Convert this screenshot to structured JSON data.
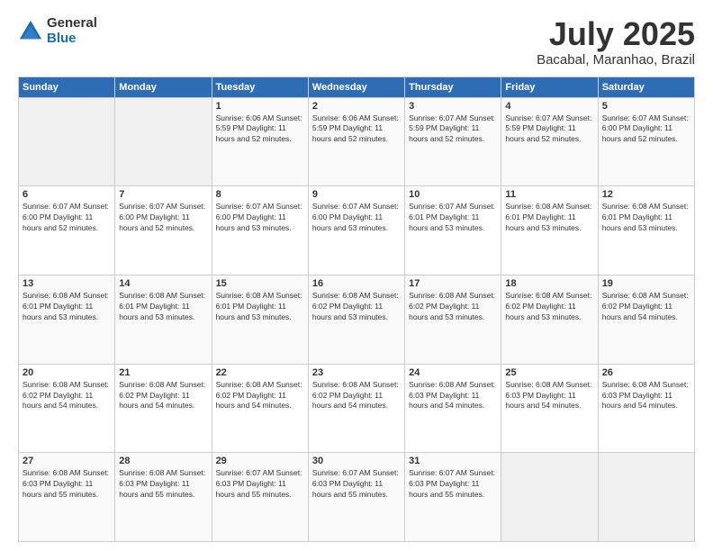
{
  "header": {
    "logo_general": "General",
    "logo_blue": "Blue",
    "title": "July 2025",
    "location": "Bacabal, Maranhao, Brazil"
  },
  "days_of_week": [
    "Sunday",
    "Monday",
    "Tuesday",
    "Wednesday",
    "Thursday",
    "Friday",
    "Saturday"
  ],
  "weeks": [
    [
      {
        "day": "",
        "info": ""
      },
      {
        "day": "",
        "info": ""
      },
      {
        "day": "1",
        "info": "Sunrise: 6:06 AM\nSunset: 5:59 PM\nDaylight: 11 hours\nand 52 minutes."
      },
      {
        "day": "2",
        "info": "Sunrise: 6:06 AM\nSunset: 5:59 PM\nDaylight: 11 hours\nand 52 minutes."
      },
      {
        "day": "3",
        "info": "Sunrise: 6:07 AM\nSunset: 5:59 PM\nDaylight: 11 hours\nand 52 minutes."
      },
      {
        "day": "4",
        "info": "Sunrise: 6:07 AM\nSunset: 5:59 PM\nDaylight: 11 hours\nand 52 minutes."
      },
      {
        "day": "5",
        "info": "Sunrise: 6:07 AM\nSunset: 6:00 PM\nDaylight: 11 hours\nand 52 minutes."
      }
    ],
    [
      {
        "day": "6",
        "info": "Sunrise: 6:07 AM\nSunset: 6:00 PM\nDaylight: 11 hours\nand 52 minutes."
      },
      {
        "day": "7",
        "info": "Sunrise: 6:07 AM\nSunset: 6:00 PM\nDaylight: 11 hours\nand 52 minutes."
      },
      {
        "day": "8",
        "info": "Sunrise: 6:07 AM\nSunset: 6:00 PM\nDaylight: 11 hours\nand 53 minutes."
      },
      {
        "day": "9",
        "info": "Sunrise: 6:07 AM\nSunset: 6:00 PM\nDaylight: 11 hours\nand 53 minutes."
      },
      {
        "day": "10",
        "info": "Sunrise: 6:07 AM\nSunset: 6:01 PM\nDaylight: 11 hours\nand 53 minutes."
      },
      {
        "day": "11",
        "info": "Sunrise: 6:08 AM\nSunset: 6:01 PM\nDaylight: 11 hours\nand 53 minutes."
      },
      {
        "day": "12",
        "info": "Sunrise: 6:08 AM\nSunset: 6:01 PM\nDaylight: 11 hours\nand 53 minutes."
      }
    ],
    [
      {
        "day": "13",
        "info": "Sunrise: 6:08 AM\nSunset: 6:01 PM\nDaylight: 11 hours\nand 53 minutes."
      },
      {
        "day": "14",
        "info": "Sunrise: 6:08 AM\nSunset: 6:01 PM\nDaylight: 11 hours\nand 53 minutes."
      },
      {
        "day": "15",
        "info": "Sunrise: 6:08 AM\nSunset: 6:01 PM\nDaylight: 11 hours\nand 53 minutes."
      },
      {
        "day": "16",
        "info": "Sunrise: 6:08 AM\nSunset: 6:02 PM\nDaylight: 11 hours\nand 53 minutes."
      },
      {
        "day": "17",
        "info": "Sunrise: 6:08 AM\nSunset: 6:02 PM\nDaylight: 11 hours\nand 53 minutes."
      },
      {
        "day": "18",
        "info": "Sunrise: 6:08 AM\nSunset: 6:02 PM\nDaylight: 11 hours\nand 53 minutes."
      },
      {
        "day": "19",
        "info": "Sunrise: 6:08 AM\nSunset: 6:02 PM\nDaylight: 11 hours\nand 54 minutes."
      }
    ],
    [
      {
        "day": "20",
        "info": "Sunrise: 6:08 AM\nSunset: 6:02 PM\nDaylight: 11 hours\nand 54 minutes."
      },
      {
        "day": "21",
        "info": "Sunrise: 6:08 AM\nSunset: 6:02 PM\nDaylight: 11 hours\nand 54 minutes."
      },
      {
        "day": "22",
        "info": "Sunrise: 6:08 AM\nSunset: 6:02 PM\nDaylight: 11 hours\nand 54 minutes."
      },
      {
        "day": "23",
        "info": "Sunrise: 6:08 AM\nSunset: 6:02 PM\nDaylight: 11 hours\nand 54 minutes."
      },
      {
        "day": "24",
        "info": "Sunrise: 6:08 AM\nSunset: 6:03 PM\nDaylight: 11 hours\nand 54 minutes."
      },
      {
        "day": "25",
        "info": "Sunrise: 6:08 AM\nSunset: 6:03 PM\nDaylight: 11 hours\nand 54 minutes."
      },
      {
        "day": "26",
        "info": "Sunrise: 6:08 AM\nSunset: 6:03 PM\nDaylight: 11 hours\nand 54 minutes."
      }
    ],
    [
      {
        "day": "27",
        "info": "Sunrise: 6:08 AM\nSunset: 6:03 PM\nDaylight: 11 hours\nand 55 minutes."
      },
      {
        "day": "28",
        "info": "Sunrise: 6:08 AM\nSunset: 6:03 PM\nDaylight: 11 hours\nand 55 minutes."
      },
      {
        "day": "29",
        "info": "Sunrise: 6:07 AM\nSunset: 6:03 PM\nDaylight: 11 hours\nand 55 minutes."
      },
      {
        "day": "30",
        "info": "Sunrise: 6:07 AM\nSunset: 6:03 PM\nDaylight: 11 hours\nand 55 minutes."
      },
      {
        "day": "31",
        "info": "Sunrise: 6:07 AM\nSunset: 6:03 PM\nDaylight: 11 hours\nand 55 minutes."
      },
      {
        "day": "",
        "info": ""
      },
      {
        "day": "",
        "info": ""
      }
    ]
  ]
}
